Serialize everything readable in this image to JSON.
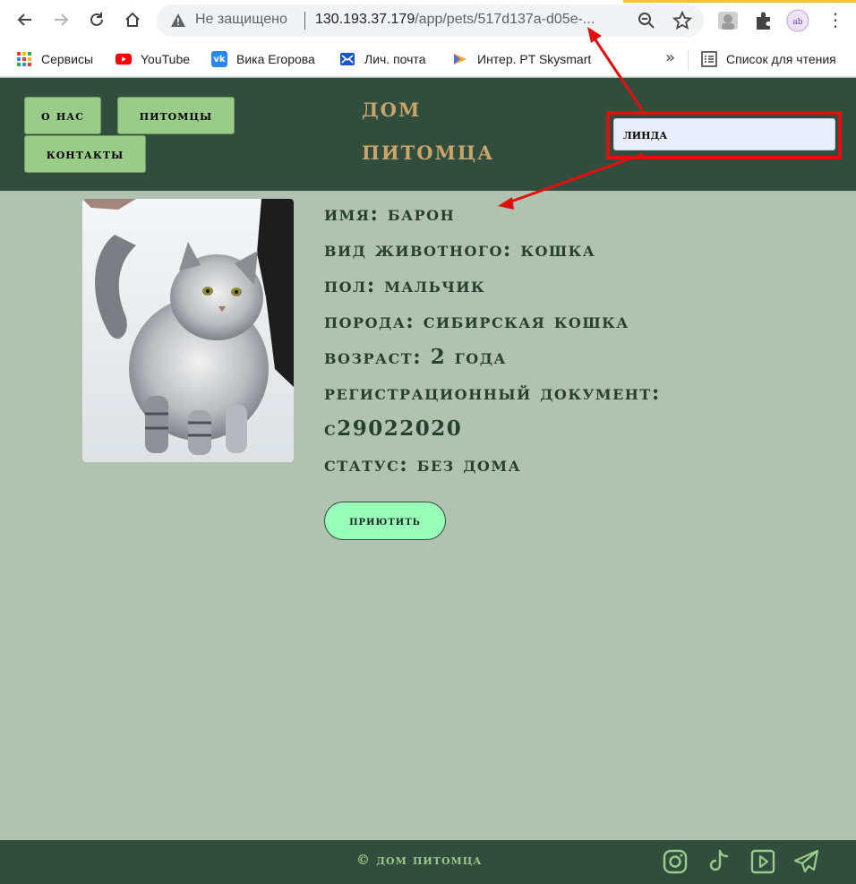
{
  "browser": {
    "security_label": "Не защищено",
    "url_host": "130.193.37.179",
    "url_path": "/app/pets/517d137a-d05e-...",
    "bookmarks": [
      {
        "label": "Сервисы",
        "icon": "apps-grid-icon"
      },
      {
        "label": "YouTube",
        "icon": "youtube-icon",
        "color": "#ff0000"
      },
      {
        "label": "Вика Егорова",
        "icon": "vk-icon",
        "color": "#2787f5"
      },
      {
        "label": "Лич. почта",
        "icon": "mail-icon",
        "color": "#1a56c4"
      },
      {
        "label": "Интер. PT Skysmart",
        "icon": "skysmart-icon",
        "color": "#f5a623"
      }
    ],
    "more_bookmarks": "»",
    "reading_list": "Список для чтения"
  },
  "header": {
    "nav": [
      "о нас",
      "питомцы",
      "контакты"
    ],
    "title_line1": "дом",
    "title_line2": "питомца",
    "search_value": "линда"
  },
  "pet": {
    "name_line": "имя: Барон",
    "type_line": "вид животного: кошка",
    "gender_line": "пол: мальчик",
    "breed_line": "порода: сибирская кошка",
    "age_line": "возраст: 2 года",
    "doc_label": "регистрационный документ:",
    "doc_value": "C29022020",
    "status_line": "статус: без дома",
    "adopt_label": "приютить"
  },
  "footer": {
    "copyright": "© дом питомца",
    "social": [
      "instagram-icon",
      "tiktok-icon",
      "youtube-play-icon",
      "telegram-icon"
    ]
  },
  "colors": {
    "header_bg": "#314d3d",
    "page_bg": "#b1c2b1",
    "nav_button": "#99cc88",
    "title": "#c9a56a",
    "adopt_button": "#99ffbb",
    "annotation": "#e01010"
  }
}
